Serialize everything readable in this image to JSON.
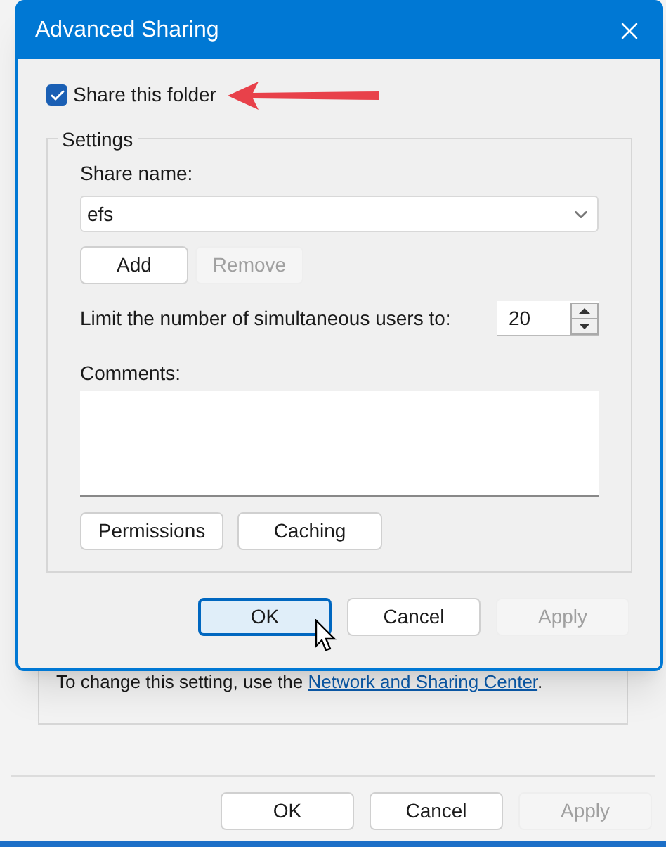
{
  "background_window": {
    "note": {
      "text": "To change this setting, use the ",
      "link": "Network and Sharing Center",
      "end": "."
    },
    "buttons": [
      {
        "label": "OK",
        "disabled": false
      },
      {
        "label": "Cancel",
        "disabled": false
      },
      {
        "label": "Apply",
        "disabled": true
      }
    ]
  },
  "dialog": {
    "title": "Advanced Sharing",
    "share_checkbox": {
      "label": "Share this folder",
      "checked": true
    },
    "settings": {
      "title": "Settings",
      "share_name_label": "Share name:",
      "share_name_value": "efs",
      "name_buttons": [
        {
          "label": "Add",
          "disabled": false
        },
        {
          "label": "Remove",
          "disabled": true
        }
      ],
      "limit_label": "Limit the number of simultaneous users to:",
      "limit_value": "20",
      "comments_label": "Comments:",
      "buttons": [
        {
          "label": "Permissions",
          "disabled": false
        },
        {
          "label": "Caching",
          "disabled": false
        }
      ]
    },
    "buttons": [
      {
        "label": "OK",
        "disabled": false,
        "focused": true
      },
      {
        "label": "Cancel",
        "disabled": false,
        "focused": false
      },
      {
        "label": "Apply",
        "disabled": true,
        "focused": false
      }
    ]
  }
}
